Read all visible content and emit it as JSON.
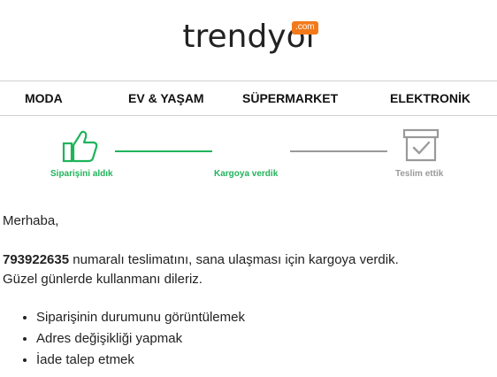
{
  "brand": {
    "logo_text": "trendyol",
    "logo_badge": ".com",
    "accent": "#f27a1a"
  },
  "nav": {
    "items": [
      {
        "label": "MODA"
      },
      {
        "label": "EV & YAŞAM"
      },
      {
        "label": "SÜPERMARKET"
      },
      {
        "label": "ELEKTRONİK"
      }
    ]
  },
  "progress": {
    "steps": [
      {
        "label": "Siparişini aldık",
        "status": "done",
        "icon": "thumbs-up-icon"
      },
      {
        "label": "Kargoya verdik",
        "status": "done",
        "icon": ""
      },
      {
        "label": "Teslim ettik",
        "status": "pending",
        "icon": "delivered-box-icon"
      }
    ],
    "colors": {
      "done": "#1fb45a",
      "pending": "#9a9a9a"
    }
  },
  "message": {
    "greeting": "Merhaba,",
    "tracking_number": "793922635",
    "body_line1_rest": " numaralı teslimatını, sana ulaşması için kargoya verdik.",
    "body_line2": "Güzel günlerde kullanmanı dileriz.",
    "bullets": [
      "Siparişinin durumunu görüntülemek",
      "Adres değişikliği yapmak",
      "İade talep etmek"
    ]
  }
}
